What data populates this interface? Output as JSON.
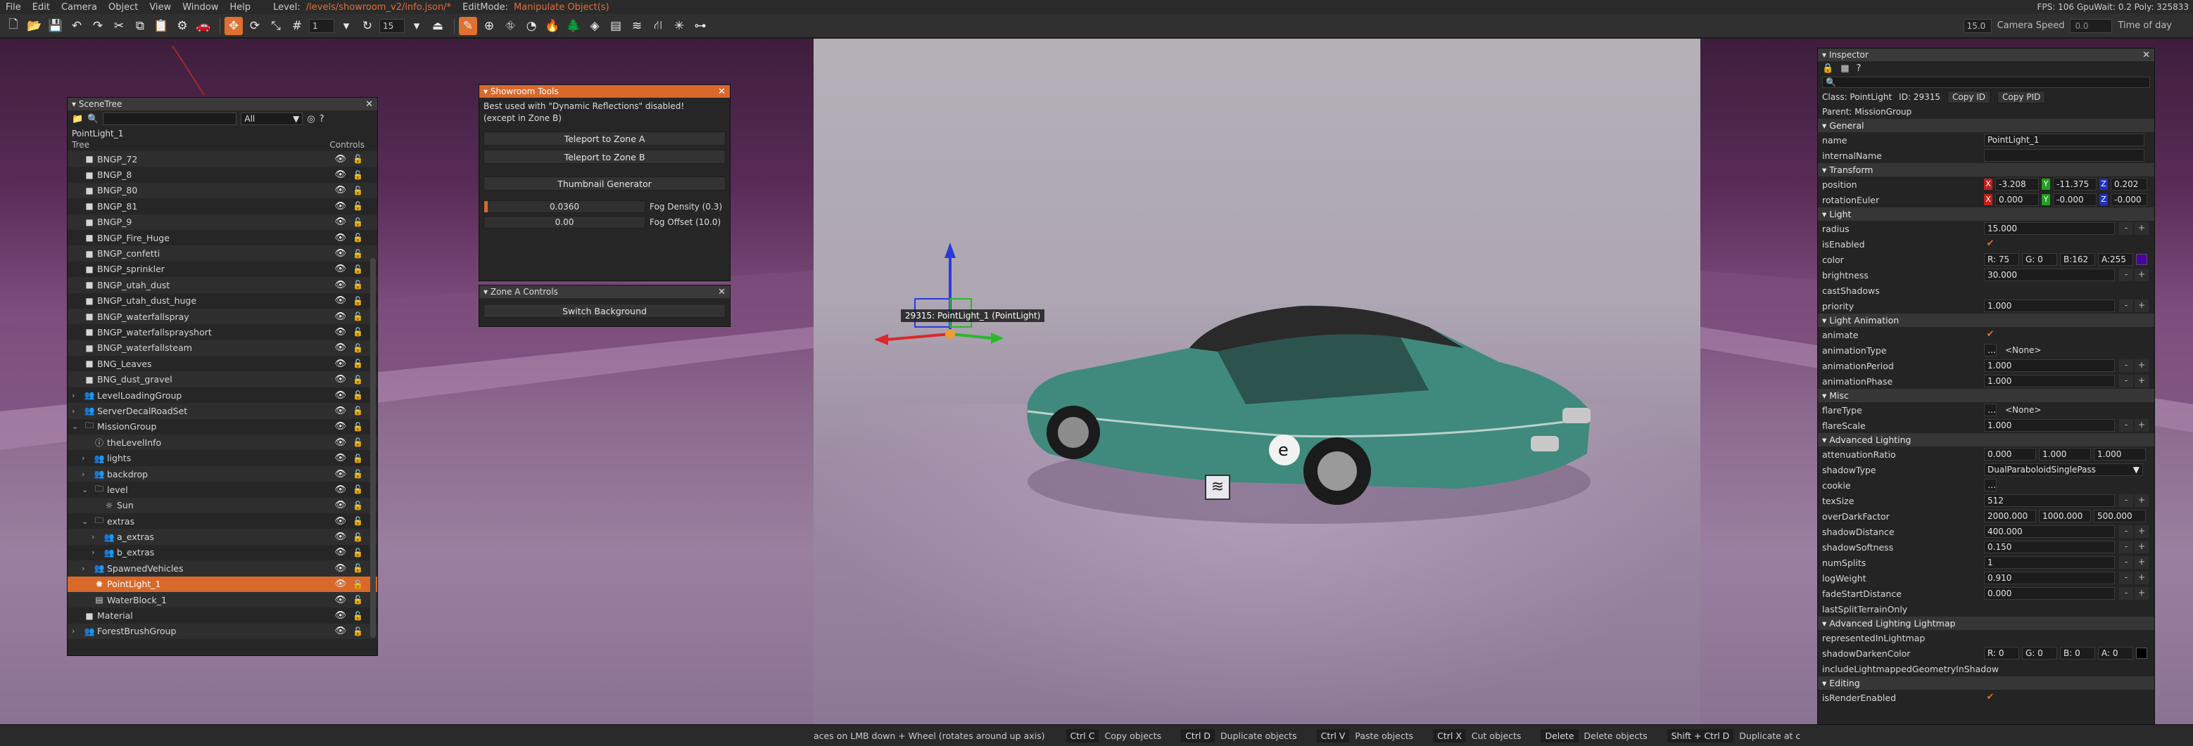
{
  "menubar": {
    "items": [
      "File",
      "Edit",
      "Camera",
      "Object",
      "View",
      "Window",
      "Help"
    ],
    "level_label": "Level:",
    "level_path": "/levels/showroom_v2/info.json/*",
    "editmode_label": "EditMode:",
    "editmode_value": "Manipulate Object(s)",
    "stats": "FPS: 106  GpuWait: 0.2  Poly: 325833"
  },
  "toolbar": {
    "snap_value": "1",
    "rot_value": "15",
    "fov_value": "15.0",
    "camera_speed_label": "Camera Speed",
    "camera_speed_value": "0.0",
    "time_of_day_label": "Time of day"
  },
  "scenetree": {
    "title": "SceneTree",
    "filter_value": "All",
    "selected_path": "PointLight_1",
    "col_tree": "Tree",
    "col_controls": "Controls",
    "rows": [
      {
        "label": "BNGP_72",
        "indent": 0,
        "arrow": "",
        "icon": "square"
      },
      {
        "label": "BNGP_8",
        "indent": 0,
        "arrow": "",
        "icon": "square"
      },
      {
        "label": "BNGP_80",
        "indent": 0,
        "arrow": "",
        "icon": "square"
      },
      {
        "label": "BNGP_81",
        "indent": 0,
        "arrow": "",
        "icon": "square"
      },
      {
        "label": "BNGP_9",
        "indent": 0,
        "arrow": "",
        "icon": "square"
      },
      {
        "label": "BNGP_Fire_Huge",
        "indent": 0,
        "arrow": "",
        "icon": "square"
      },
      {
        "label": "BNGP_confetti",
        "indent": 0,
        "arrow": "",
        "icon": "square"
      },
      {
        "label": "BNGP_sprinkler",
        "indent": 0,
        "arrow": "",
        "icon": "square"
      },
      {
        "label": "BNGP_utah_dust",
        "indent": 0,
        "arrow": "",
        "icon": "square"
      },
      {
        "label": "BNGP_utah_dust_huge",
        "indent": 0,
        "arrow": "",
        "icon": "square"
      },
      {
        "label": "BNGP_waterfallspray",
        "indent": 0,
        "arrow": "",
        "icon": "square"
      },
      {
        "label": "BNGP_waterfallsprayshort",
        "indent": 0,
        "arrow": "",
        "icon": "square"
      },
      {
        "label": "BNGP_waterfallsteam",
        "indent": 0,
        "arrow": "",
        "icon": "square"
      },
      {
        "label": "BNG_Leaves",
        "indent": 0,
        "arrow": "",
        "icon": "square"
      },
      {
        "label": "BNG_dust_gravel",
        "indent": 0,
        "arrow": "",
        "icon": "square"
      },
      {
        "label": "LevelLoadingGroup",
        "indent": 0,
        "arrow": "›",
        "icon": "group"
      },
      {
        "label": "ServerDecalRoadSet",
        "indent": 0,
        "arrow": "›",
        "icon": "group"
      },
      {
        "label": "MissionGroup",
        "indent": 0,
        "arrow": "⌄",
        "icon": "folder"
      },
      {
        "label": "theLevelInfo",
        "indent": 1,
        "arrow": "",
        "icon": "info"
      },
      {
        "label": "lights",
        "indent": 1,
        "arrow": "›",
        "icon": "group"
      },
      {
        "label": "backdrop",
        "indent": 1,
        "arrow": "›",
        "icon": "group"
      },
      {
        "label": "level",
        "indent": 1,
        "arrow": "⌄",
        "icon": "folder"
      },
      {
        "label": "Sun",
        "indent": 2,
        "arrow": "",
        "icon": "sun"
      },
      {
        "label": "extras",
        "indent": 1,
        "arrow": "⌄",
        "icon": "folder"
      },
      {
        "label": "a_extras",
        "indent": 2,
        "arrow": "›",
        "icon": "group"
      },
      {
        "label": "b_extras",
        "indent": 2,
        "arrow": "›",
        "icon": "group"
      },
      {
        "label": "SpawnedVehicles",
        "indent": 1,
        "arrow": "›",
        "icon": "group"
      },
      {
        "label": "PointLight_1",
        "indent": 1,
        "arrow": "",
        "icon": "light",
        "selected": true
      },
      {
        "label": "WaterBlock_1",
        "indent": 1,
        "arrow": "",
        "icon": "water"
      },
      {
        "label": "Material",
        "indent": 0,
        "arrow": "",
        "icon": "square"
      },
      {
        "label": "ForestBrushGroup",
        "indent": 0,
        "arrow": "›",
        "icon": "group"
      }
    ]
  },
  "showroom": {
    "title": "Showroom Tools",
    "note1": "Best used with \"Dynamic Reflections\" disabled!",
    "note2": "(except in Zone B)",
    "btn_zone_a": "Teleport to Zone A",
    "btn_zone_b": "Teleport to Zone B",
    "btn_thumb": "Thumbnail Generator",
    "fog_density_value": "0.0360",
    "fog_density_label": "Fog Density (0.3)",
    "fog_density_fraction": 0.02,
    "fog_offset_value": "0.00",
    "fog_offset_label": "Fog Offset (10.0)"
  },
  "zonea": {
    "title": "Zone A Controls",
    "btn_switch": "Switch Background"
  },
  "gizmo": {
    "label": "29315: PointLight_1 (PointLight)"
  },
  "inspector": {
    "title": "Inspector",
    "class_label": "Class: PointLight",
    "id_label": "ID: 29315",
    "copy_id": "Copy ID",
    "copy_pid": "Copy PID",
    "parent": "Parent: MissionGroup",
    "sec_general": "General",
    "name_label": "name",
    "name_value": "PointLight_1",
    "internal_label": "internalName",
    "sec_transform": "Transform",
    "position_label": "position",
    "pos_x": "-3.208",
    "pos_y": "-11.375",
    "pos_z": "0.202",
    "rotation_label": "rotationEuler",
    "rot_x": "0.000",
    "rot_y": "-0.000",
    "rot_z": "-0.000",
    "sec_light": "Light",
    "radius_label": "radius",
    "radius_value": "15.000",
    "enabled_label": "isEnabled",
    "color_label": "color",
    "color_r": "R: 75",
    "color_g": "G: 0",
    "color_b": "B:162",
    "color_a": "A:255",
    "color_swatch": "#4b00a2",
    "brightness_label": "brightness",
    "brightness_value": "30.000",
    "cast_label": "castShadows",
    "priority_label": "priority",
    "priority_value": "1.000",
    "sec_anim": "Light Animation",
    "animate_label": "animate",
    "animtype_label": "animationType",
    "animtype_value": "<None>",
    "animperiod_label": "animationPeriod",
    "animperiod_value": "1.000",
    "animphase_label": "animationPhase",
    "animphase_value": "1.000",
    "sec_misc": "Misc",
    "flaretype_label": "flareType",
    "flaretype_value": "<None>",
    "flarescale_label": "flareScale",
    "flarescale_value": "1.000",
    "sec_adv": "Advanced Lighting",
    "atten_label": "attenuationRatio",
    "atten_1": "0.000",
    "atten_2": "1.000",
    "atten_3": "1.000",
    "shadowtype_label": "shadowType",
    "shadowtype_value": "DualParaboloidSinglePass",
    "cookie_label": "cookie",
    "texsize_label": "texSize",
    "texsize_value": "512",
    "overdark_label": "overDarkFactor",
    "overdark_1": "2000.000",
    "overdark_2": "1000.000",
    "overdark_3": "500.000",
    "shadowdist_label": "shadowDistance",
    "shadowdist_value": "400.000",
    "shadowsoft_label": "shadowSoftness",
    "shadowsoft_value": "0.150",
    "numsplits_label": "numSplits",
    "numsplits_value": "1",
    "logweight_label": "logWeight",
    "logweight_value": "0.910",
    "fadestart_label": "fadeStartDistance",
    "fadestart_value": "0.000",
    "lastsplit_label": "lastSplitTerrainOnly",
    "sec_advlm": "Advanced Lighting Lightmap",
    "repr_label": "representedInLightmap",
    "shadowdarken_label": "shadowDarkenColor",
    "sd_r": "R: 0",
    "sd_g": "G: 0",
    "sd_b": "B: 0",
    "sd_a": "A: 0",
    "include_label": "includeLightmappedGeometryInShadow",
    "sec_editing": "Editing",
    "render_label": "isRenderEnabled"
  },
  "statusbar": {
    "hint": "aces on LMB down + Wheel (rotates around up axis)",
    "shortcuts": [
      {
        "key": "Ctrl C",
        "desc": "Copy objects"
      },
      {
        "key": "Ctrl D",
        "desc": "Duplicate objects"
      },
      {
        "key": "Ctrl V",
        "desc": "Paste objects"
      },
      {
        "key": "Ctrl X",
        "desc": "Cut objects"
      },
      {
        "key": "Delete",
        "desc": "Delete objects"
      },
      {
        "key": "Shift + Ctrl D",
        "desc": "Duplicate at c"
      }
    ]
  }
}
